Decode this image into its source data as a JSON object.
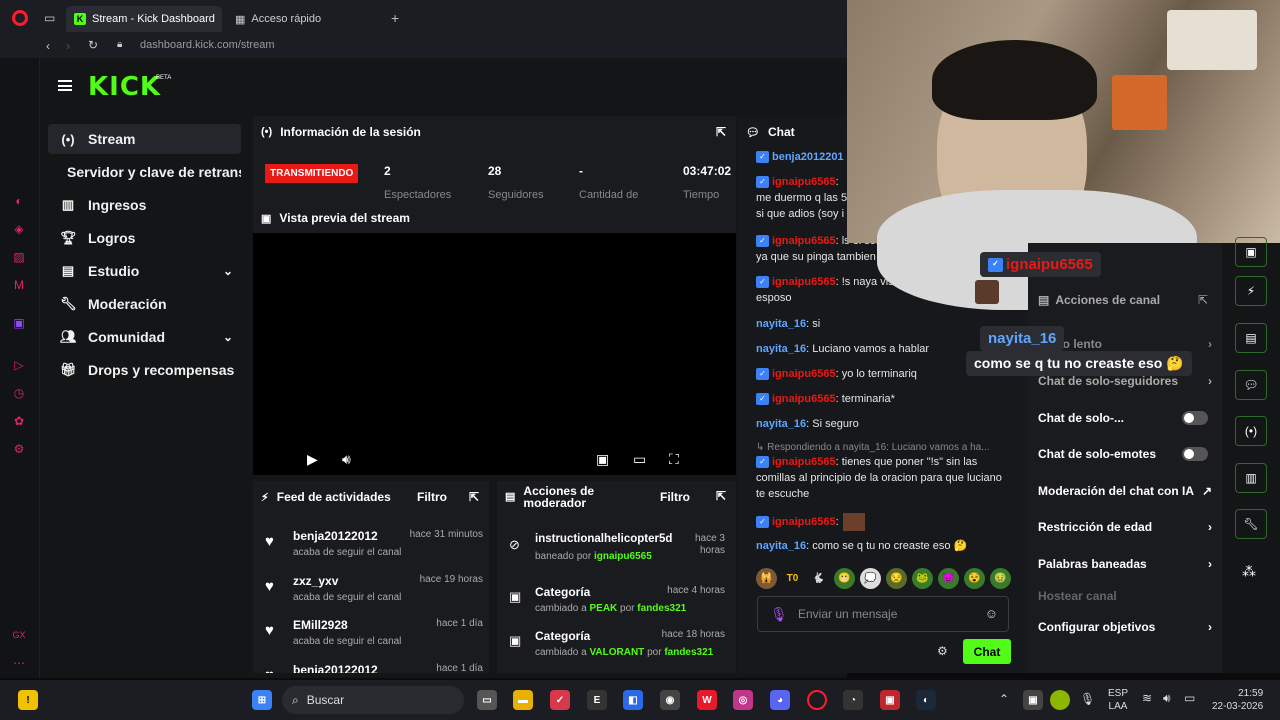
{
  "browser": {
    "active_tab": "Stream - Kick Dashboard",
    "tab2": "Acceso rápido",
    "new_tab": "+",
    "url": "dashboard.kick.com/stream"
  },
  "app": {
    "logo": "KICK",
    "logo_badge": "BETA"
  },
  "nav": [
    {
      "label": "Stream",
      "icon": "broadcast-icon"
    },
    {
      "label": "Servidor y clave de retransmisión",
      "icon": ""
    },
    {
      "label": "Ingresos",
      "icon": "chart-icon"
    },
    {
      "label": "Logros",
      "icon": "trophy-icon"
    },
    {
      "label": "Estudio",
      "icon": "studio-icon"
    },
    {
      "label": "Moderación",
      "icon": "wrench-icon"
    },
    {
      "label": "Comunidad",
      "icon": "people-icon"
    },
    {
      "label": "Drops y recompensas",
      "icon": "gift-icon"
    }
  ],
  "session": {
    "title": "Información de la sesión",
    "status": "TRANSMITIENDO",
    "viewers": "2",
    "viewers_label": "Espectadores",
    "followers": "28",
    "followers_label": "Seguidores",
    "subs": "-",
    "subs_label": "Cantidad de",
    "time": "03:47:02",
    "time_label": "Tiempo"
  },
  "preview": {
    "title": "Vista previa del stream"
  },
  "feed": {
    "title": "Feed de actividades",
    "filter": "Filtro",
    "items": [
      {
        "name": "benja20122012",
        "sub": "acaba de seguir el canal",
        "time": "hace 31 minutos"
      },
      {
        "name": "zxz_yxv",
        "sub": "acaba de seguir el canal",
        "time": "hace 19 horas"
      },
      {
        "name": "EMill2928",
        "sub": "acaba de seguir el canal",
        "time": "hace 1 día"
      },
      {
        "name": "benja20122012",
        "sub": "",
        "time": "hace 1 día"
      }
    ]
  },
  "mod_actions": {
    "title": "Acciones de moderador",
    "filter": "Filtro",
    "items": [
      {
        "name": "instructionalhelicopter5d",
        "sub_prefix": "baneado por ",
        "actor": "ignaipu6565",
        "time": "hace 3 horas"
      },
      {
        "name": "Categoría",
        "sub_prefix": "cambiado a ",
        "target": "PEAK",
        "actor_prefix": " por ",
        "actor": "fandes321",
        "time": "hace 4 horas"
      },
      {
        "name": "Categoría",
        "sub_prefix": "cambiado a ",
        "target": "VALORANT",
        "actor_prefix": " por ",
        "actor": "fandes321",
        "time": "hace 18 horas"
      }
    ]
  },
  "chat": {
    "title": "Chat",
    "messages": [
      {
        "user": "benja2012201",
        "text": "",
        "color": "blue",
        "badge": true
      },
      {
        "user": "ignaipu6565",
        "text": ": me duermo q las 5 si que adios (soy i",
        "color": "red",
        "badge": true
      },
      {
        "user": "ignaipu6565",
        "text": ": ls el sonido de barro es marron ya que su pinga tambien es marron",
        "color": "red",
        "badge": true
      },
      {
        "user": "ignaipu6565",
        "text": ": !s naya viste lo que ve tu esposo",
        "color": "red",
        "badge": true
      },
      {
        "user": "nayita_16",
        "text": ": si",
        "color": "blue",
        "badge": false
      },
      {
        "user": "nayita_16",
        "text": ": Luciano vamos a hablar",
        "color": "blue",
        "badge": false
      },
      {
        "user": "ignaipu6565",
        "text": ": yo lo terminariq",
        "color": "red",
        "badge": true
      },
      {
        "user": "ignaipu6565",
        "text": ": terminaria*",
        "color": "red",
        "badge": true
      },
      {
        "user": "nayita_16",
        "text": ": Si seguro",
        "color": "blue",
        "badge": false
      },
      {
        "user": "ignaipu6565",
        "text": ": tienes que poner \"!s\" sin las comillas al principio de la oracion para que luciano te escuche",
        "color": "red",
        "badge": true
      },
      {
        "user": "ignaipu6565",
        "text": ":",
        "color": "red",
        "badge": true
      },
      {
        "user": "nayita_16",
        "text": ": como se q tu no creaste eso 🤔",
        "color": "blue",
        "badge": false
      }
    ],
    "reply_note": "↳ Respondiendo a nayita_16: Luciano vamos a ha...",
    "emotes": [
      "🙀",
      "T0",
      "🐇",
      "😬",
      "💭",
      "😒",
      "🐸",
      "😈",
      "😵",
      "🤢",
      "🤮"
    ],
    "input_placeholder": "Enviar un mensaje",
    "send_label": "Chat"
  },
  "channel_actions": {
    "title": "Acciones de canal",
    "items": [
      {
        "label": "Modo lento",
        "type": "chevron"
      },
      {
        "label": "Chat de solo-seguidores",
        "type": "chevron"
      },
      {
        "label": "Chat de solo-...",
        "type": "toggle"
      },
      {
        "label": "Chat de solo-emotes",
        "type": "toggle"
      },
      {
        "label": "Moderación del chat con IA",
        "type": "link"
      },
      {
        "label": "Restricción de edad",
        "type": "chevron"
      },
      {
        "label": "Palabras baneadas",
        "type": "chevron"
      },
      {
        "label": "Hostear canal",
        "type": "disabled"
      },
      {
        "label": "Configurar objetivos",
        "type": "chevron"
      }
    ]
  },
  "overlay": {
    "user1": "ignaipu6565",
    "user2": "nayita_16",
    "message": "como se q tu no creaste eso 🤔"
  },
  "taskbar": {
    "search": "Buscar",
    "lang": "ESP",
    "lang2": "LAA",
    "time": "21:59",
    "date": "22-03-2026"
  },
  "colors": {
    "kick_green": "#53fc18",
    "live_red": "#e91916",
    "user_red": "#e91916",
    "user_blue": "#5ea6ff"
  }
}
